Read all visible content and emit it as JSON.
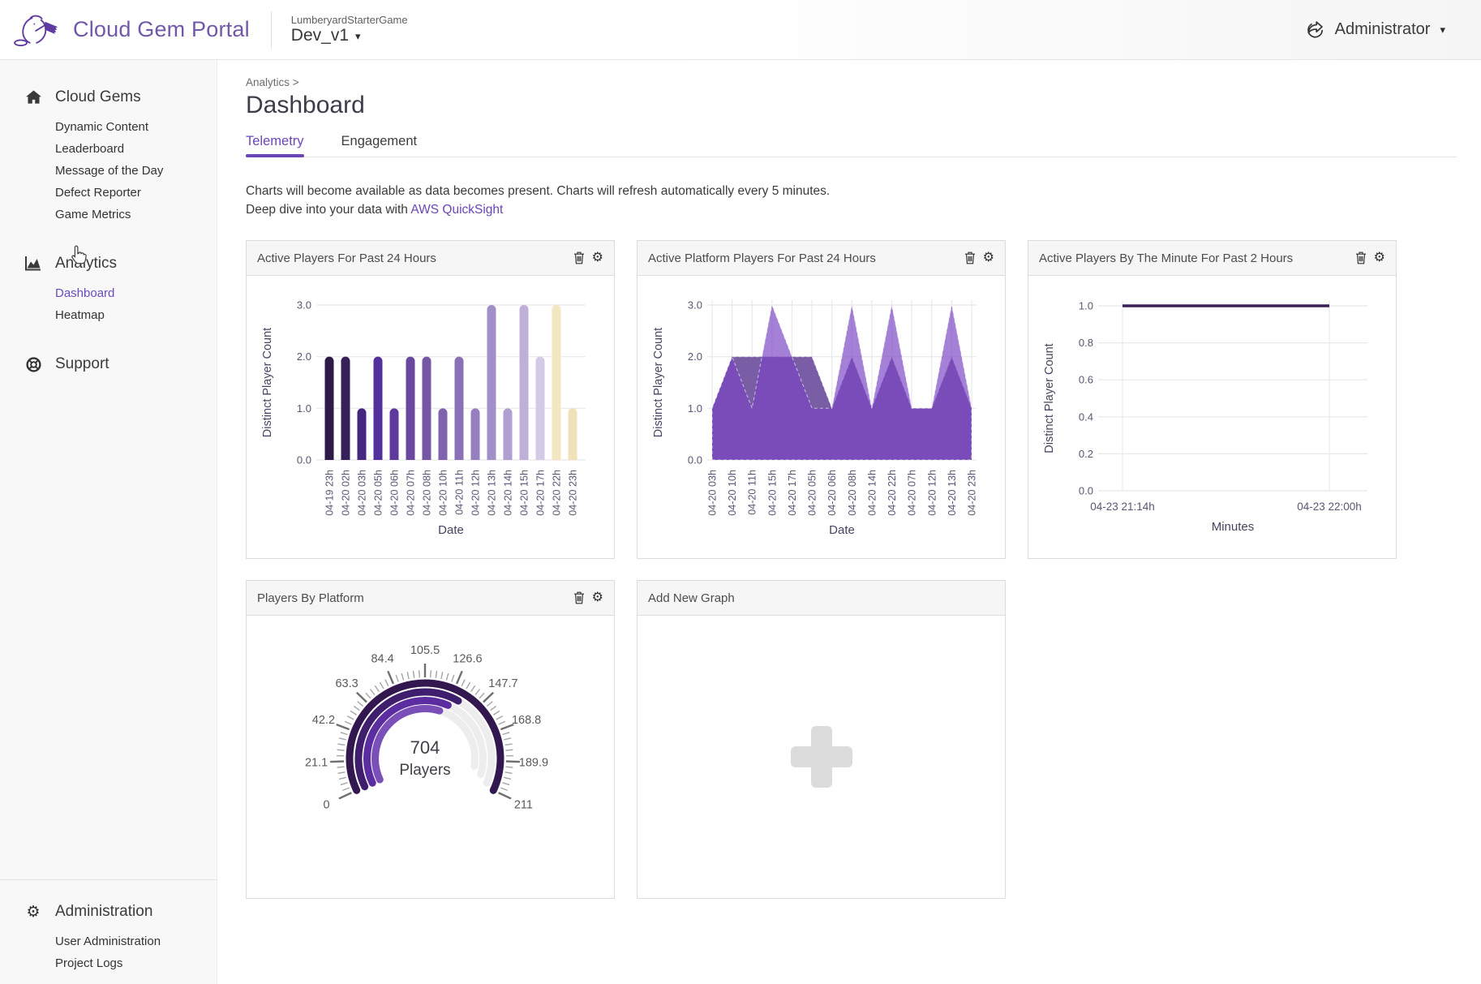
{
  "header": {
    "app_title": "Cloud Gem Portal",
    "project_name": "LumberyardStarterGame",
    "deployment": "Dev_v1",
    "user": "Administrator"
  },
  "icons": {
    "caret_down": "▾",
    "gear": "⚙",
    "breadcrumb_separator": ">"
  },
  "sidebar": {
    "sections": [
      {
        "label": "Cloud Gems",
        "icon": "home-icon",
        "position": "top",
        "items": [
          "Dynamic Content",
          "Leaderboard",
          "Message of the Day",
          "Defect Reporter",
          "Game Metrics"
        ]
      },
      {
        "label": "Analytics",
        "icon": "analytics-icon",
        "position": "top",
        "items": [
          "Dashboard",
          "Heatmap"
        ],
        "active_item": "Dashboard"
      },
      {
        "label": "Support",
        "icon": "lifebuoy-icon",
        "position": "top",
        "items": []
      },
      {
        "label": "Administration",
        "icon": "gear-icon",
        "position": "bottom",
        "items": [
          "User Administration",
          "Project Logs"
        ]
      }
    ]
  },
  "main": {
    "breadcrumb": "Analytics >",
    "page_title": "Dashboard",
    "tabs": [
      {
        "label": "Telemetry",
        "active": true
      },
      {
        "label": "Engagement",
        "active": false
      }
    ],
    "notice_line1": "Charts will become available as data becomes present. Charts will refresh automatically every 5 minutes.",
    "notice_line2_prefix": "Deep dive into your data with ",
    "notice_link": "AWS QuickSight",
    "add_card_title": "Add New Graph"
  },
  "colors": {
    "accent_purple": "#6a45b8",
    "brand_purple": "#7258a8",
    "grid": "#e8e8e8",
    "axis_tick_text": "#5d5475",
    "axis_title_text": "#4b4160",
    "line_purple": "#3b2156",
    "gauge_track": "#ededed",
    "tick_major": "#6f6f6f",
    "tick_minor": "#a5a5a5",
    "gauge_label": "#5a5a5a",
    "center_text": "#3f3f46"
  },
  "chart_data": [
    {
      "type": "bar",
      "title": "Active Players For Past 24 Hours",
      "xlabel": "Date",
      "ylabel": "Distinct Player Count",
      "ylim": [
        0,
        3
      ],
      "ytick_labels": [
        "0.0",
        "1.0",
        "2.0",
        "3.0"
      ],
      "categories": [
        "04-19 23h",
        "04-20 02h",
        "04-20 03h",
        "04-20 05h",
        "04-20 06h",
        "04-20 07h",
        "04-20 08h",
        "04-20 10h",
        "04-20 11h",
        "04-20 12h",
        "04-20 13h",
        "04-20 14h",
        "04-20 15h",
        "04-20 17h",
        "04-20 22h",
        "04-20 23h"
      ],
      "values": [
        2,
        2,
        1,
        2,
        1,
        2,
        2,
        1,
        2,
        1,
        3,
        1,
        3,
        2,
        3,
        1
      ],
      "bar_colors": [
        "#2d1a47",
        "#35205a",
        "#44277f",
        "#53309b",
        "#5d3a9c",
        "#6a489f",
        "#7557a6",
        "#7f64ad",
        "#8a71b5",
        "#967fbe",
        "#a38fc7",
        "#b19fd1",
        "#bfb0da",
        "#d3cae6",
        "#f3e6c3",
        "#f0e1b9"
      ]
    },
    {
      "type": "area",
      "title": "Active Platform Players For Past 24 Hours",
      "xlabel": "Date",
      "ylabel": "Distinct Player Count",
      "ylim": [
        0,
        3
      ],
      "ytick_labels": [
        "0.0",
        "1.0",
        "2.0",
        "3.0"
      ],
      "categories": [
        "04-20 03h",
        "04-20 10h",
        "04-20 11h",
        "04-20 15h",
        "04-20 17h",
        "04-20 05h",
        "04-20 06h",
        "04-20 08h",
        "04-20 14h",
        "04-20 22h",
        "04-20 07h",
        "04-20 12h",
        "04-20 13h",
        "04-20 23h"
      ],
      "series": [
        {
          "name": "platform-series-1",
          "color": "#6b4d9b",
          "opacity": 0.9,
          "values": [
            1,
            2,
            2,
            2,
            2,
            2,
            1,
            2,
            1,
            2,
            1,
            1,
            2,
            1
          ]
        },
        {
          "name": "platform-series-2",
          "color": "#7b44c4",
          "opacity": 0.68,
          "values": [
            1,
            2,
            1,
            3,
            2,
            1,
            1,
            3,
            1,
            3,
            1,
            1,
            3,
            1
          ]
        }
      ]
    },
    {
      "type": "line",
      "title": "Active Players By The Minute For Past 2 Hours",
      "xlabel": "Minutes",
      "ylabel": "Distinct Player Count",
      "ylim": [
        0,
        1
      ],
      "ytick_labels": [
        "0.0",
        "0.2",
        "0.4",
        "0.6",
        "0.8",
        "1.0"
      ],
      "x_ticks": [
        "04-23 21:14h",
        "04-23 22:00h"
      ],
      "values": [
        1,
        1
      ],
      "line_color": "#3b2156"
    },
    {
      "type": "gauge",
      "title": "Players By Platform",
      "center_value": "704",
      "center_label": "Players",
      "scale_min": 0,
      "scale_max": 211,
      "tick_labels": [
        "0",
        "21.1",
        "42.2",
        "63.3",
        "84.4",
        "105.5",
        "126.6",
        "147.7",
        "168.8",
        "189.9",
        "211"
      ],
      "rings": [
        {
          "value": 211,
          "color": "#33184f"
        },
        {
          "value": 133,
          "color": "#3e1e6d"
        },
        {
          "value": 127,
          "color": "#5b2da0"
        },
        {
          "value": 121,
          "color": "#7a50b8"
        }
      ],
      "track_color": "#ededed"
    }
  ]
}
